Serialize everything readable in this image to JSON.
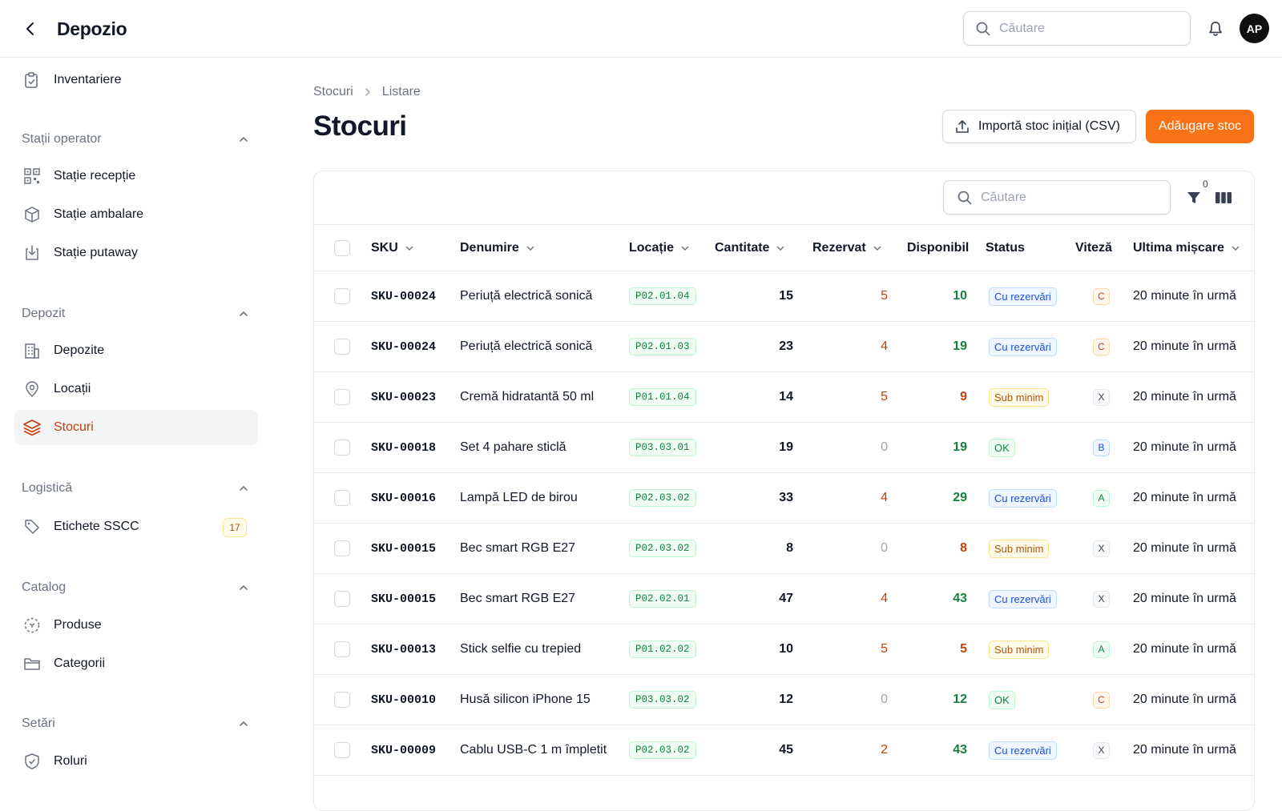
{
  "header": {
    "app_title": "Depozio",
    "search_placeholder": "Căutare",
    "avatar_initials": "AP"
  },
  "sidebar": {
    "top_item": "Inventariere",
    "sections": [
      {
        "title": "Stații operator",
        "items": [
          "Stație recepție",
          "Stație ambalare",
          "Stație putaway"
        ]
      },
      {
        "title": "Depozit",
        "items": [
          "Depozite",
          "Locații",
          "Stocuri"
        ]
      },
      {
        "title": "Logistică",
        "items": [
          "Etichete SSCC"
        ],
        "badge": "17"
      },
      {
        "title": "Catalog",
        "items": [
          "Produse",
          "Categorii"
        ]
      },
      {
        "title": "Setări",
        "items": [
          "Roluri"
        ]
      }
    ],
    "active_item": "Stocuri"
  },
  "breadcrumb": [
    "Stocuri",
    "Listare"
  ],
  "page_title": "Stocuri",
  "actions": {
    "import_label": "Importă stoc inițial (CSV)",
    "add_label": "Adăugare stoc"
  },
  "toolbar": {
    "search_placeholder": "Căutare",
    "filter_count": "0"
  },
  "table": {
    "columns": [
      "SKU",
      "Denumire",
      "Locație",
      "Cantitate",
      "Rezervat",
      "Disponibil",
      "Status",
      "Viteză",
      "Ultima mișcare"
    ],
    "rows": [
      {
        "sku": "SKU-00024",
        "name": "Periuță electrică sonică",
        "loc": "P02.01.04",
        "qty": "15",
        "res": "5",
        "disp": "10",
        "status": "Cu rezervări",
        "speed": "C",
        "last": "20 minute în urmă"
      },
      {
        "sku": "SKU-00024",
        "name": "Periuță electrică sonică",
        "loc": "P02.01.03",
        "qty": "23",
        "res": "4",
        "disp": "19",
        "status": "Cu rezervări",
        "speed": "C",
        "last": "20 minute în urmă"
      },
      {
        "sku": "SKU-00023",
        "name": "Cremă hidratantă 50 ml",
        "loc": "P01.01.04",
        "qty": "14",
        "res": "5",
        "disp": "9",
        "status": "Sub minim",
        "speed": "X",
        "last": "20 minute în urmă"
      },
      {
        "sku": "SKU-00018",
        "name": "Set 4 pahare sticlă",
        "loc": "P03.03.01",
        "qty": "19",
        "res": "0",
        "disp": "19",
        "status": "OK",
        "speed": "B",
        "last": "20 minute în urmă"
      },
      {
        "sku": "SKU-00016",
        "name": "Lampă LED de birou",
        "loc": "P02.03.02",
        "qty": "33",
        "res": "4",
        "disp": "29",
        "status": "Cu rezervări",
        "speed": "A",
        "last": "20 minute în urmă"
      },
      {
        "sku": "SKU-00015",
        "name": "Bec smart RGB E27",
        "loc": "P02.03.02",
        "qty": "8",
        "res": "0",
        "disp": "8",
        "status": "Sub minim",
        "speed": "X",
        "last": "20 minute în urmă"
      },
      {
        "sku": "SKU-00015",
        "name": "Bec smart RGB E27",
        "loc": "P02.02.01",
        "qty": "47",
        "res": "4",
        "disp": "43",
        "status": "Cu rezervări",
        "speed": "X",
        "last": "20 minute în urmă"
      },
      {
        "sku": "SKU-00013",
        "name": "Stick selfie cu trepied",
        "loc": "P01.02.02",
        "qty": "10",
        "res": "5",
        "disp": "5",
        "status": "Sub minim",
        "speed": "A",
        "last": "20 minute în urmă"
      },
      {
        "sku": "SKU-00010",
        "name": "Husă silicon iPhone 15",
        "loc": "P03.03.02",
        "qty": "12",
        "res": "0",
        "disp": "12",
        "status": "OK",
        "speed": "C",
        "last": "20 minute în urmă"
      },
      {
        "sku": "SKU-00009",
        "name": "Cablu USB-C 1 m împletit",
        "loc": "P02.03.02",
        "qty": "45",
        "res": "2",
        "disp": "43",
        "status": "Cu rezervări",
        "speed": "X",
        "last": "20 minute în urmă"
      }
    ]
  }
}
